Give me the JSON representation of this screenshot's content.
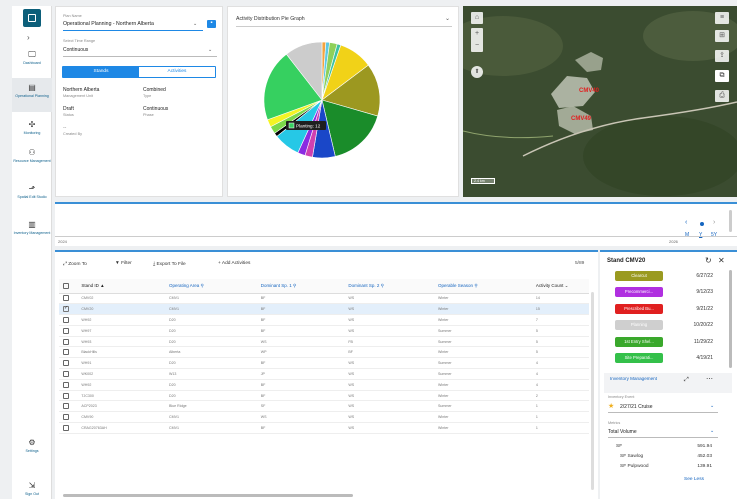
{
  "sidebar": {
    "items": [
      {
        "label": "Dashboard",
        "icon": "monitor-icon"
      },
      {
        "label": "Operational Planning",
        "icon": "document-icon"
      },
      {
        "label": "Monitoring",
        "icon": "drone-icon"
      },
      {
        "label": "Resource Management",
        "icon": "hierarchy-icon"
      },
      {
        "label": "Spatial Edit Studio",
        "icon": "map-edit-icon"
      },
      {
        "label": "Inventory Management",
        "icon": "bar-chart-icon"
      }
    ],
    "settings_label": "Settings",
    "signout_label": "Sign Out"
  },
  "plan": {
    "plan_name_label": "Plan Name",
    "plan_name_value": "Operational Planning - Northern Alberta",
    "time_range_label": "Select Time Range",
    "time_range_value": "Continuous",
    "tab_stands": "Stands",
    "tab_activities": "Activities",
    "fields": [
      {
        "value": "Northern Alberta",
        "label": "Management Unit"
      },
      {
        "value": "Combined",
        "label": "Type"
      },
      {
        "value": "Draft",
        "label": "Status"
      },
      {
        "value": "Continuous",
        "label": "Phase"
      },
      {
        "value": "--",
        "label": "Created By"
      }
    ]
  },
  "pie": {
    "title": "Activity Distribution Pie Graph",
    "tooltip": "Planting: 12"
  },
  "chart_data": {
    "type": "pie",
    "title": "Activity Distribution Pie Graph",
    "slices": [
      {
        "color": "#f4a340",
        "value": 1
      },
      {
        "color": "#5ec8e3",
        "value": 1
      },
      {
        "color": "#8fd05a",
        "value": 2
      },
      {
        "color": "#3ec2a2",
        "value": 1
      },
      {
        "color": "#f1d218",
        "value": 9
      },
      {
        "color": "#9c9820",
        "value": 14
      },
      {
        "color": "#1a8c2a",
        "value": 16
      },
      {
        "color": "#1a47c8",
        "value": 6
      },
      {
        "color": "#d040b0",
        "value": 2
      },
      {
        "color": "#8a2be2",
        "value": 2
      },
      {
        "color": "#26c8e6",
        "value": 7
      },
      {
        "color": "#000000",
        "value": 1
      },
      {
        "color": "#7cd84a",
        "value": 2
      },
      {
        "color": "#f4f424",
        "value": 2
      },
      {
        "color": "#36d060",
        "value": 19
      },
      {
        "color": "#cccccc",
        "value": 10
      }
    ]
  },
  "map": {
    "scale_text": "2.4 km",
    "labels": [
      "CMV40",
      "CMV49"
    ]
  },
  "timeline": {
    "start": "2024",
    "end": "2026",
    "zoom_m": "M",
    "zoom_y": "Y",
    "zoom_5y": "5Y"
  },
  "toolbar": {
    "zoom_to": "Zoom To",
    "filter": "Filter",
    "export": "Export To File",
    "add": "Add Activities",
    "count": "5/89"
  },
  "table": {
    "columns": [
      "Stand ID",
      "Operating Area",
      "Dominant Sp. 1",
      "Dominant Sp. 2",
      "Operable Season",
      "Activity Count"
    ],
    "rows": [
      {
        "id": "CMV02",
        "area": "CMV1",
        "sp1": "BF",
        "sp2": "WS",
        "season": "Winter",
        "count": "14"
      },
      {
        "id": "CMV20",
        "area": "CMV1",
        "sp1": "BF",
        "sp2": "WS",
        "season": "Winter",
        "count": "15"
      },
      {
        "id": "WH92",
        "area": "D20",
        "sp1": "BF",
        "sp2": "WS",
        "season": "Winter",
        "count": "7"
      },
      {
        "id": "WH97",
        "area": "D20",
        "sp1": "BF",
        "sp2": "WS",
        "season": "Summer",
        "count": "5"
      },
      {
        "id": "WH93",
        "area": "D20",
        "sp1": "WS",
        "sp2": "FB",
        "season": "Summer",
        "count": "5"
      },
      {
        "id": "BlackHills",
        "area": "Alberta",
        "sp1": "WP",
        "sp2": "BF",
        "season": "Winter",
        "count": "5"
      },
      {
        "id": "WH91",
        "area": "D20",
        "sp1": "BF",
        "sp2": "WS",
        "season": "Summer",
        "count": "4"
      },
      {
        "id": "WK002",
        "area": "W13",
        "sp1": "JP",
        "sp2": "WS",
        "season": "Summer",
        "count": "4"
      },
      {
        "id": "WH92",
        "area": "D20",
        "sp1": "BF",
        "sp2": "WS",
        "season": "Winter",
        "count": "4"
      },
      {
        "id": "TJC300",
        "area": "D20",
        "sp1": "BF",
        "sp2": "WS",
        "season": "Winter",
        "count": "2"
      },
      {
        "id": "ACP2023",
        "area": "Blue Ridge",
        "sp1": "SF",
        "sp2": "WS",
        "season": "Summer",
        "count": "1"
      },
      {
        "id": "CMV90",
        "area": "CMV1",
        "sp1": "WS",
        "sp2": "WS",
        "season": "Winter",
        "count": "1"
      },
      {
        "id": "CRAG20763AH",
        "area": "CMV1",
        "sp1": "BF",
        "sp2": "WS",
        "season": "Winter",
        "count": "1"
      }
    ]
  },
  "stand": {
    "title": "Stand CMV20",
    "activities": [
      {
        "label": "Clearcut",
        "date": "6/27/22",
        "color": "#9a9a20"
      },
      {
        "label": "Precommerci...",
        "date": "9/12/23",
        "color": "#b030e0"
      },
      {
        "label": "Prescribed Bu...",
        "date": "9/21/22",
        "color": "#e02020"
      },
      {
        "label": "Planning",
        "date": "10/20/22",
        "color": "#cfcfcf"
      },
      {
        "label": "1st Entry Shel...",
        "date": "11/29/22",
        "color": "#3aa82c"
      },
      {
        "label": "Site Preparati...",
        "date": "4/19/21",
        "color": "#34c04a"
      }
    ],
    "inventory_label": "Inventory Management",
    "event_label": "Inventory Event",
    "event_value": "2/27/21 Cruise",
    "metrics_label": "Metrics",
    "metrics_value": "Total Volume",
    "metric_rows": [
      {
        "name": "SF",
        "value": "591.94"
      },
      {
        "name": "SF Sawlog",
        "value": "452.03"
      },
      {
        "name": "SF Pulpwood",
        "value": "139.91"
      }
    ],
    "see_less": "See Less"
  }
}
